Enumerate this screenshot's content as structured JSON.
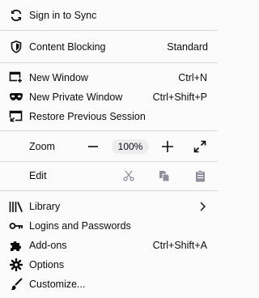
{
  "menu": {
    "sync": {
      "label": "Sign in to Sync",
      "icon": "sync-icon"
    },
    "content_blocking": {
      "label": "Content Blocking",
      "value": "Standard",
      "icon": "shield-icon"
    },
    "new_window": {
      "label": "New Window",
      "shortcut": "Ctrl+N",
      "icon": "new-window-icon"
    },
    "new_private_window": {
      "label": "New Private Window",
      "shortcut": "Ctrl+Shift+P",
      "icon": "private-mask-icon"
    },
    "restore_session": {
      "label": "Restore Previous Session",
      "icon": "restore-session-icon"
    },
    "zoom": {
      "label": "Zoom",
      "level": "100%",
      "zoom_out_icon": "minus-icon",
      "zoom_in_icon": "plus-icon",
      "fullscreen_icon": "fullscreen-icon"
    },
    "edit": {
      "label": "Edit",
      "cut_icon": "scissors-icon",
      "copy_icon": "copy-icon",
      "paste_icon": "clipboard-icon"
    },
    "library": {
      "label": "Library",
      "icon": "library-icon",
      "arrow_icon": "chevron-right-icon"
    },
    "logins": {
      "label": "Logins and Passwords",
      "icon": "key-icon"
    },
    "addons": {
      "label": "Add-ons",
      "shortcut": "Ctrl+Shift+A",
      "icon": "puzzle-icon"
    },
    "options": {
      "label": "Options",
      "icon": "gear-icon"
    },
    "customize": {
      "label": "Customize...",
      "icon": "paintbrush-icon"
    }
  }
}
